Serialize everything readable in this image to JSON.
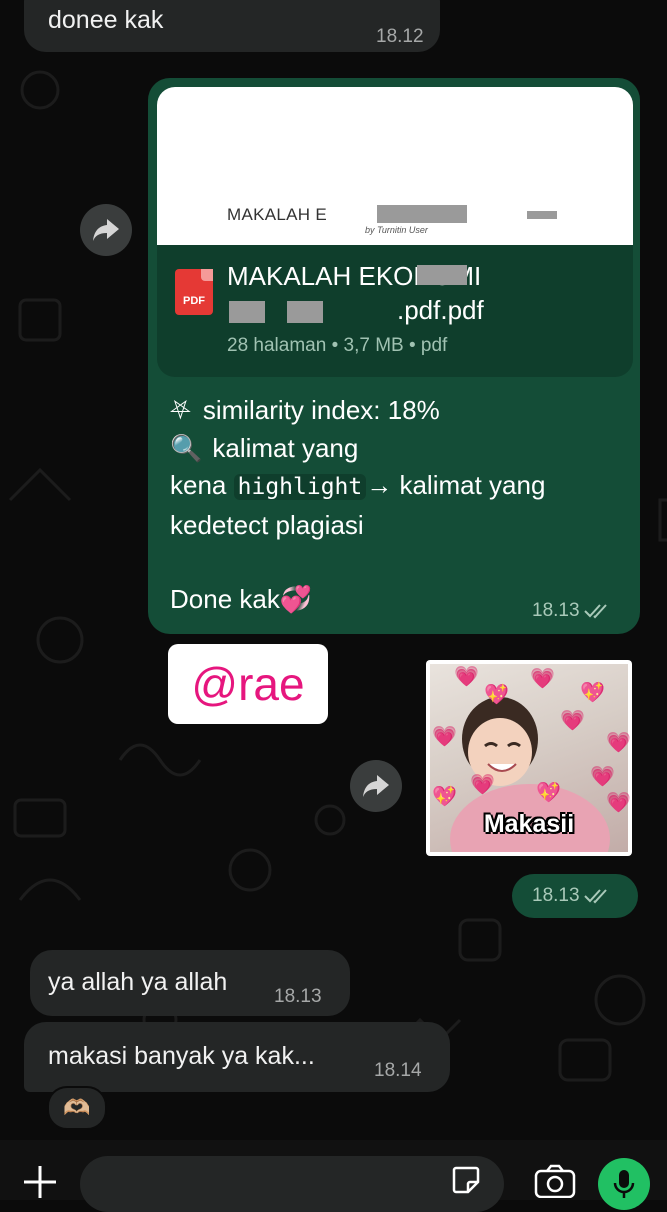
{
  "messages": {
    "top_in": {
      "text": "donee kak",
      "time": "18.12"
    },
    "document": {
      "preview_title": "MAKALAH E",
      "preview_by": "by Turnitin User",
      "file_name": "MAKALAH EKONOMI",
      "file_name_suffix": ".pdf.pdf",
      "meta": "28 halaman • 3,7 MB • pdf",
      "type_label": "PDF"
    },
    "caption": {
      "line1_icon": "⛧",
      "line1": "similarity index: 18%",
      "line2_icon": "🔍",
      "line2": "kalimat yang",
      "line3_pre": "kena",
      "line3_code": "highlight",
      "line3_post": "→ kalimat yang",
      "line4": "kedetect plagiasi",
      "line5": "Done kak💞",
      "time": "18.13"
    },
    "mention_sticker": {
      "text": "@rae"
    },
    "image_sticker": {
      "caption": "Makasii",
      "time": "18.13"
    },
    "in_1": {
      "text": "ya allah ya allah",
      "time": "18.13"
    },
    "in_2": {
      "text": "makasi banyak ya kak...",
      "time": "18.14"
    },
    "reaction": {
      "emoji": "🫶🏼"
    }
  },
  "icons": {
    "forward": "forward-icon",
    "read_receipt": "double-check-icon",
    "plus": "plus-icon",
    "sticker": "sticker-icon",
    "camera": "camera-icon",
    "mic": "microphone-icon"
  },
  "colors": {
    "outgoing_bubble": "#144d37",
    "incoming_bubble": "#242626",
    "mic_button": "#21c063",
    "mention_text": "#e6167e"
  }
}
